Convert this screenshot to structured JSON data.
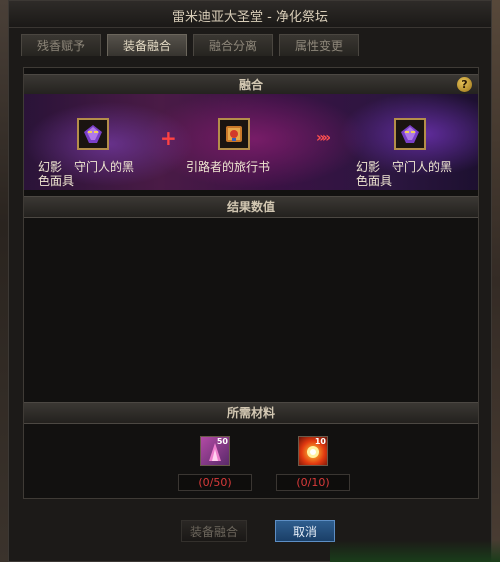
{
  "window": {
    "title": "雷米迪亚大圣堂 - 净化祭坛"
  },
  "tabs": [
    {
      "label": "残香赋予",
      "active": false
    },
    {
      "label": "装备融合",
      "active": true
    },
    {
      "label": "融合分离",
      "active": false
    },
    {
      "label": "属性变更",
      "active": false
    }
  ],
  "fusion": {
    "header": "融合",
    "help_icon": "?",
    "item_a": {
      "line1": "幻影　守门人的黑",
      "line2": "色面具",
      "icon": "mask-icon"
    },
    "plus_icon": "+",
    "item_b": {
      "label": "引路者的旅行书",
      "icon": "book-icon"
    },
    "arrow_icon": "»»",
    "item_result": {
      "line1": "幻影　守门人的黑",
      "line2": "色面具",
      "icon": "mask-icon"
    }
  },
  "result": {
    "header": "结果数值"
  },
  "materials": {
    "header": "所需材料",
    "items": [
      {
        "count": "50",
        "qty": "(0/50)",
        "icon": "crystal-icon"
      },
      {
        "count": "10",
        "qty": "(0/10)",
        "icon": "fire-orb-icon"
      }
    ]
  },
  "buttons": {
    "fuse": "装备融合",
    "cancel": "取消"
  }
}
